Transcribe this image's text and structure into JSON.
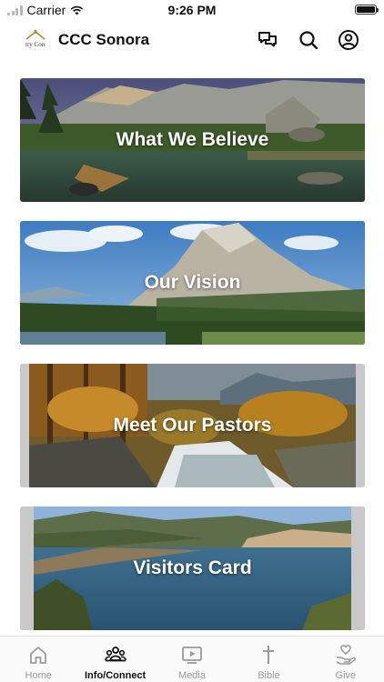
{
  "status_bar": {
    "carrier": "Carrier",
    "time": "9:26 PM"
  },
  "header": {
    "title": "CCC Sonora",
    "logo_text": "try Con"
  },
  "cards": [
    {
      "label": "What We Believe"
    },
    {
      "label": "Our Vision"
    },
    {
      "label": "Meet Our Pastors"
    },
    {
      "label": "Visitors Card"
    }
  ],
  "tabs": [
    {
      "label": "Home",
      "icon": "home-icon",
      "active": false
    },
    {
      "label": "Info/Connect",
      "icon": "people-icon",
      "active": true
    },
    {
      "label": "Media",
      "icon": "media-icon",
      "active": false
    },
    {
      "label": "Bible",
      "icon": "cross-icon",
      "active": false
    },
    {
      "label": "Give",
      "icon": "give-icon",
      "active": false
    }
  ],
  "colors": {
    "active_tab": "#111111",
    "inactive_tab": "#999999",
    "card_text": "#ffffff"
  }
}
